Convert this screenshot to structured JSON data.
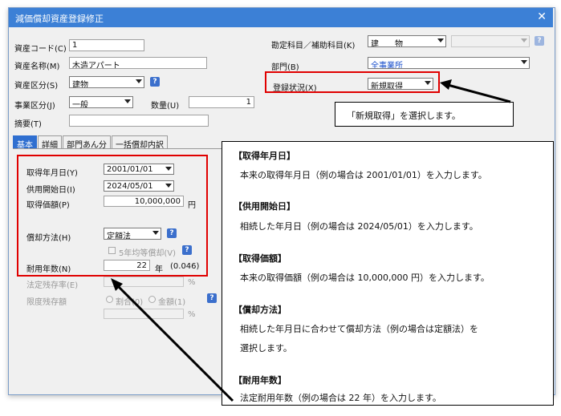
{
  "window": {
    "title": "減価償却資産登録修正",
    "close_symbol": "✕"
  },
  "fields": {
    "asset_code": {
      "label": "資産コード(C)",
      "value": "1"
    },
    "asset_name": {
      "label": "資産名称(M)",
      "value": "木造アパート"
    },
    "asset_category": {
      "label": "資産区分(S)",
      "value": "建物"
    },
    "business_category": {
      "label": "事業区分(J)",
      "value": "一般"
    },
    "quantity": {
      "label": "数量(U)",
      "value": "1"
    },
    "summary": {
      "label": "摘要(T)",
      "value": ""
    },
    "account": {
      "label": "勘定科目／補助科目(K)",
      "value": "建　　物",
      "sub_value": ""
    },
    "department": {
      "label": "部門(B)",
      "value": "全事業所"
    },
    "registration_status": {
      "label": "登録状況(X)",
      "value": "新規取得"
    }
  },
  "tabs": [
    "基本",
    "詳細",
    "部門あん分",
    "一括償却内訳"
  ],
  "basic": {
    "acquisition_date": {
      "label": "取得年月日(Y)",
      "value": "2001/01/01"
    },
    "service_start_date": {
      "label": "供用開始日(I)",
      "value": "2024/05/01"
    },
    "acquisition_price": {
      "label": "取得価額(P)",
      "value": "10,000,000",
      "unit": "円"
    },
    "depreciation_method": {
      "label": "償却方法(H)",
      "value": "定額法"
    },
    "five_year_equal": {
      "label": "5年均等償却(V)"
    },
    "useful_life": {
      "label": "耐用年数(N)",
      "value": "22",
      "unit": "年",
      "rate": "(0.046)"
    },
    "legal_residual_rate": {
      "label": "法定残存率(E)",
      "unit": "%"
    },
    "limit_residual": {
      "label": "限度残存額",
      "option1": "割合(0)",
      "option2": "金額(1)",
      "unit": "%"
    }
  },
  "callouts": {
    "status_note": "「新規取得」を選択します。",
    "items": [
      {
        "heading": "【取得年月日】",
        "body": "本来の取得年月日（例の場合は 2001/01/01）を入力します。"
      },
      {
        "heading": "【供用開始日】",
        "body": "相続した年月日（例の場合は 2024/05/01）を入力します。"
      },
      {
        "heading": "【取得価額】",
        "body": "本来の取得価額（例の場合は 10,000,000 円）を入力します。"
      },
      {
        "heading": "【償却方法】",
        "body": "相続した年月日に合わせて償却方法（例の場合は定額法）を",
        "body2": "選択します。"
      },
      {
        "heading": "【耐用年数】",
        "body": "法定耐用年数（例の場合は 22 年）を入力します。"
      }
    ]
  },
  "colors": {
    "titlebar": "#3c80d6",
    "highlight": "#e00000",
    "tab_active": "#2f6fd0"
  }
}
